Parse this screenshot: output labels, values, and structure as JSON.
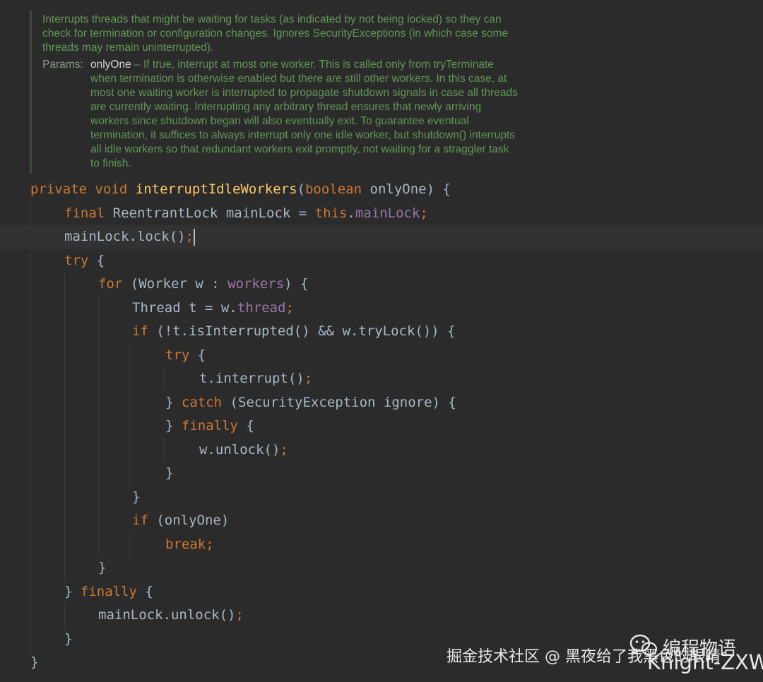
{
  "javadoc": {
    "summary": "Interrupts threads that might be waiting for tasks (as indicated by not being locked) so they can\ncheck for termination or configuration changes. Ignores SecurityExceptions (in which case some\nthreads may remain uninterrupted).",
    "params_label": "Params:",
    "param_name": "onlyOne",
    "param_desc": " – If true, interrupt at most one worker. This is called only from tryTerminate\nwhen termination is otherwise enabled but there are still other workers. In this case, at\nmost one waiting worker is interrupted to propagate shutdown signals in case all threads\nare currently waiting. Interrupting any arbitrary thread ensures that newly arriving\nworkers since shutdown began will also eventually exit. To guarantee eventual\ntermination, it suffices to always interrupt only one idle worker, but shutdown() interrupts\nall idle workers so that redundant workers exit promptly, not waiting for a straggler task\nto finish."
  },
  "code": {
    "kw": {
      "private": "private",
      "void": "void",
      "boolean": "boolean",
      "final": "final",
      "this": "this",
      "try": "try",
      "for": "for",
      "if": "if",
      "catch": "catch",
      "finally": "finally",
      "break": "break"
    },
    "method_name": "interruptIdleWorkers",
    "param_name": "onlyOne",
    "lock_type": "ReentrantLock",
    "lock_var": "mainLock",
    "lock_field": "mainLock",
    "lock_call": "mainLock.lock()",
    "worker_type": "Worker",
    "worker_var": "w",
    "workers_field": "workers",
    "thread_type": "Thread",
    "thread_var": "t",
    "thread_field": "thread",
    "condition": "(!t.isInterrupted() && w.tryLock())",
    "interrupt_call": "t.interrupt()",
    "exception_type": "SecurityException",
    "exception_var": "ignore",
    "unlock_call": "w.unlock()",
    "main_unlock_call": "mainLock.unlock()"
  },
  "watermark": {
    "source": "掘金技术社区 @ 黑夜给了我黑色的眼睛",
    "account": "编程物语",
    "author": "Knight-ZXW"
  }
}
